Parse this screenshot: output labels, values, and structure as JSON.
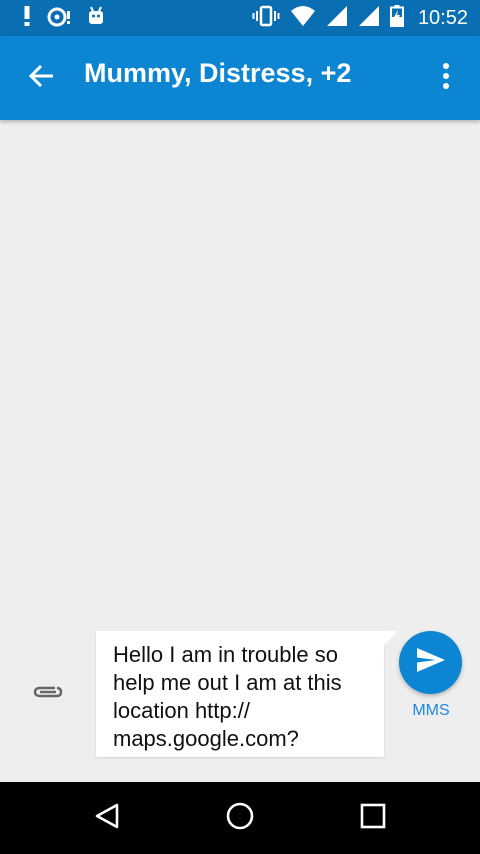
{
  "status_bar": {
    "time": "10:52",
    "icons": [
      "alert-icon",
      "sync-icon",
      "android-icon",
      "vibrate-icon",
      "wifi-icon",
      "signal-icon",
      "signal-icon",
      "battery-charging-icon"
    ]
  },
  "toolbar": {
    "title": "Mummy, Distress, +2",
    "back_icon": "arrow-back-icon",
    "menu_icon": "more-vert-icon"
  },
  "compose": {
    "message_text": "Hello I am in trouble so\nhelp me out I am at this\nlocation  http://\nmaps.google.com?",
    "attach_icon": "paperclip-icon",
    "send_icon": "send-icon",
    "send_mode_label": "MMS"
  },
  "navigation_bar": {
    "buttons": [
      "back-triangle-icon",
      "home-circle-icon",
      "recents-square-icon"
    ]
  },
  "colors": {
    "status_bar": "#0a6eb3",
    "toolbar": "#0c85d2",
    "background": "#eeeeee",
    "send_button": "#0c85d2",
    "mms_label": "#1e88e5"
  }
}
